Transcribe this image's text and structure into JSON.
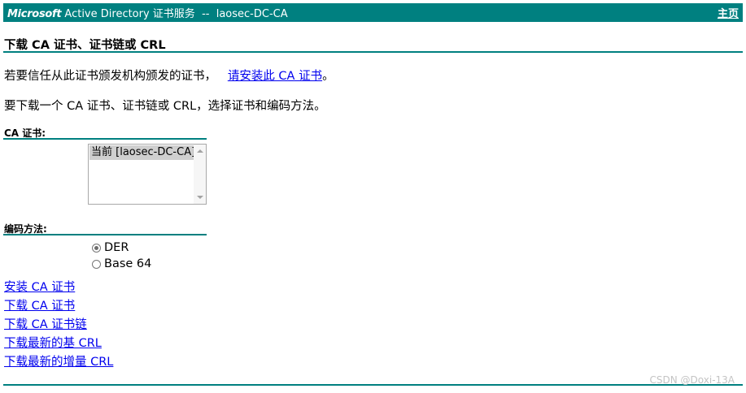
{
  "header": {
    "brand": "Microsoft",
    "title": " Active Directory 证书服务  --  laosec-DC-CA",
    "home_label": "主页"
  },
  "section_title": "下载 CA 证书、证书链或 CRL",
  "intro": {
    "text": "若要信任从此证书颁发机构颁发的证书，",
    "link_label": "请安装此 CA 证书",
    "suffix": "。"
  },
  "instruction": "要下载一个 CA 证书、证书链或 CRL，选择证书和编码方法。",
  "ca_cert": {
    "label": "CA 证书:",
    "options": [
      "当前 [laosec-DC-CA]"
    ],
    "selected_index": 0
  },
  "encoding": {
    "label": "编码方法:",
    "options": [
      {
        "label": "DER",
        "checked": true
      },
      {
        "label": "Base 64",
        "checked": false
      }
    ]
  },
  "links": {
    "install_ca": "安装 CA 证书",
    "download_ca": "下载 CA 证书",
    "download_chain": "下载 CA 证书链",
    "download_base_crl": "下载最新的基 CRL",
    "download_delta_crl": "下载最新的增量 CRL"
  },
  "watermark": "CSDN @Doxi-13A",
  "colors": {
    "header_bg": "#008080",
    "rule": "#008080",
    "link": "#0000ee"
  }
}
